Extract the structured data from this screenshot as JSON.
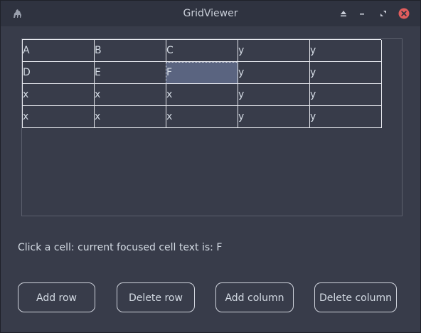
{
  "window": {
    "title": "GridViewer"
  },
  "titlebar_icons": [
    "camel-app-icon",
    "eject-icon",
    "minimize-icon",
    "maximize-icon",
    "close-icon"
  ],
  "grid": {
    "rows": [
      [
        "A",
        "B",
        "C",
        "y",
        "y"
      ],
      [
        "D",
        "E",
        "F",
        "y",
        "y"
      ],
      [
        "x",
        "x",
        "x",
        "y",
        "y"
      ],
      [
        "x",
        "x",
        "x",
        "y",
        "y"
      ]
    ],
    "focused_cell": {
      "row": 1,
      "col": 2
    }
  },
  "status": {
    "text": "Click a cell: current focused cell text is: F"
  },
  "buttons": {
    "add_row": "Add row",
    "delete_row": "Delete row",
    "add_column": "Add column",
    "delete_column": "Delete column"
  },
  "colors": {
    "window_bg": "#383c4a",
    "titlebar_bg": "#2f3340",
    "focus_bg": "#5a6480",
    "close_red": "#e05d5d"
  }
}
